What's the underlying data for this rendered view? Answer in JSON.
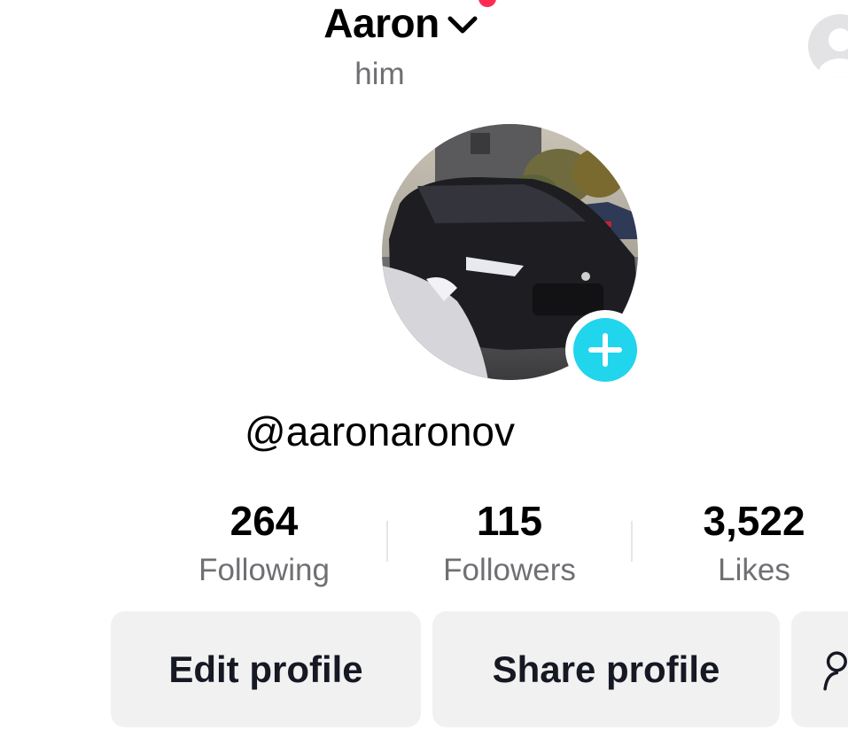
{
  "profile": {
    "display_name": "Aaron",
    "pronouns": "him",
    "handle": "@aaronaronov"
  },
  "stats": {
    "following": {
      "value": "264",
      "label": "Following"
    },
    "followers": {
      "value": "115",
      "label": "Followers"
    },
    "likes": {
      "value": "3,522",
      "label": "Likes"
    }
  },
  "actions": {
    "edit_label": "Edit profile",
    "share_label": "Share profile"
  },
  "colors": {
    "accent_add": "#20d5ec",
    "notification": "#fe2c55",
    "button_bg": "#f1f1f2",
    "muted_text": "#6f7073"
  },
  "icons": {
    "name_dropdown": "chevron-down-icon",
    "add": "plus-icon",
    "add_friends": "person-add-icon",
    "account_switch": "avatar-placeholder-icon"
  }
}
